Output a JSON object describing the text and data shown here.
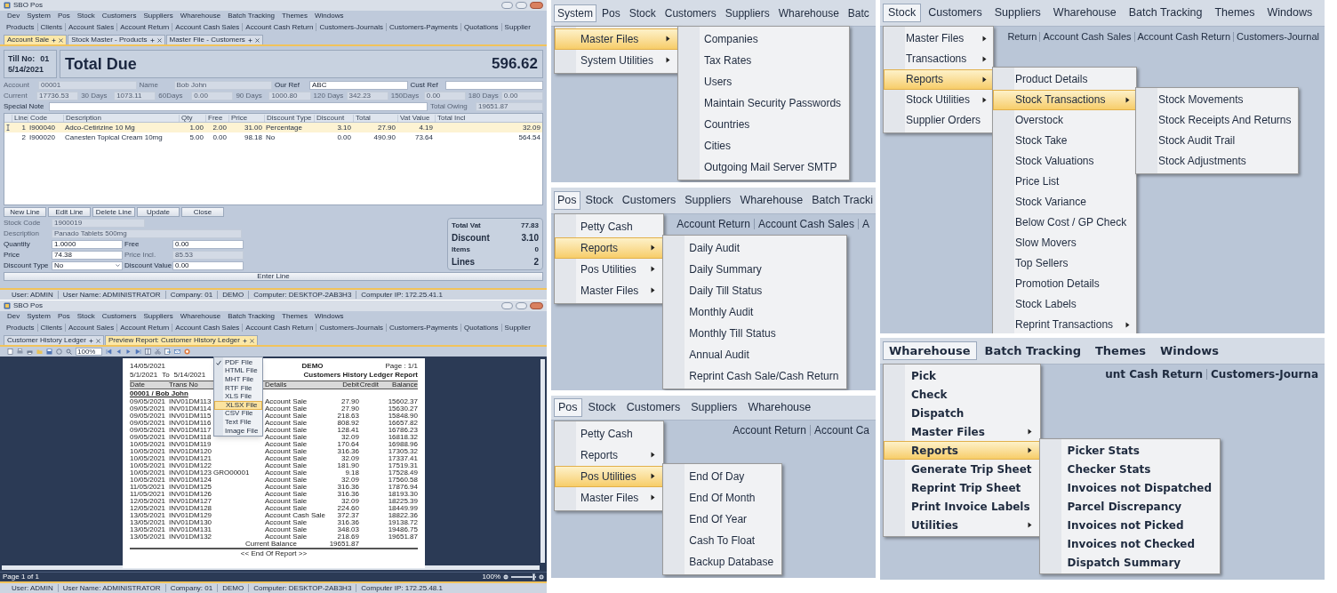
{
  "pos_window": {
    "title": "SBO Pos",
    "menubar": [
      "Dev",
      "System",
      "Pos",
      "Stock",
      "Customers",
      "Suppliers",
      "Wharehouse",
      "Batch Tracking",
      "Themes",
      "Windows"
    ],
    "toolbar": [
      "Products",
      "Clients",
      "Account Sales",
      "Account Return",
      "Account Cash Sales",
      "Account Cash Return",
      "Customers-Journals",
      "Customers-Payments",
      "Quotations",
      "Supplier"
    ],
    "tabs": [
      {
        "label": "Account Sale",
        "selected": true
      },
      {
        "label": "Stock Master - Products",
        "selected": false
      },
      {
        "label": "Master File - Customers",
        "selected": false
      }
    ],
    "till_label": "Till No:",
    "till_number": "01",
    "date": "5/14/2021",
    "total_due_label": "Total Due",
    "total_due": "596.62",
    "account_rows": [
      [
        {
          "label": "Account",
          "value": "00001",
          "editable": false
        },
        {
          "label": "Name",
          "value": "Bob John",
          "editable": false
        },
        {
          "label": "Our Ref",
          "value": "ABC",
          "editable": true
        },
        {
          "label": "Cust Ref",
          "editable": true
        }
      ],
      [
        {
          "label": "Current",
          "value": "17736.53",
          "editable": false
        },
        {
          "label": "30 Days",
          "value": "1073.11",
          "editable": false
        },
        {
          "label": "60Days",
          "value": "0.00",
          "editable": false
        },
        {
          "label": "90 Days",
          "value": "1000.80",
          "editable": false
        },
        {
          "label": "120 Days",
          "value": "342.23",
          "editable": false
        },
        {
          "label": "150Days",
          "value": "0.00",
          "editable": false
        },
        {
          "label": "180 Days",
          "value": "0.00",
          "editable": false
        }
      ],
      [
        {
          "label": "Special Note",
          "editable": true
        },
        {
          "label": "Total Owing",
          "value": "19651.87",
          "editable": false
        }
      ]
    ],
    "grid": {
      "columns": [
        "Line",
        "Code",
        "Description",
        "Qty",
        "Free",
        "Price",
        "Discount Type",
        "Discount",
        "Total",
        "Vat Value",
        "Total Incl"
      ],
      "rows": [
        {
          "selected": true,
          "cells": [
            "1",
            "I900040",
            "Adco-Cetirizine 10 Mg",
            "1.00",
            "2.00",
            "31.00",
            "Percentage",
            "3.10",
            "27.90",
            "4.19",
            "32.09"
          ]
        },
        {
          "selected": false,
          "cells": [
            "2",
            "I900020",
            "Canesten Topical Cream 10mg",
            "5.00",
            "0.00",
            "98.18",
            "No",
            "0.00",
            "490.90",
            "73.64",
            "564.54"
          ]
        }
      ]
    },
    "buttons": [
      "New Line",
      "Edit Line",
      "Delete Line",
      "Update",
      "Close"
    ],
    "line_form": [
      [
        {
          "label": "Stock Code",
          "value": "1900019",
          "editable": false,
          "kind": "text"
        }
      ],
      [
        {
          "label": "Description",
          "value": "Panado Tablets 500mg",
          "editable": false,
          "kind": "text"
        }
      ],
      [
        {
          "label": "Quantity",
          "value": "1.0000",
          "editable": true,
          "kind": "text"
        },
        {
          "label": "Free",
          "value": "0.00",
          "editable": true,
          "kind": "text"
        }
      ],
      [
        {
          "label": "Price",
          "value": "74.38",
          "editable": true,
          "kind": "text"
        },
        {
          "label": "Price Incl.",
          "value": "85.53",
          "editable": false,
          "kind": "text"
        }
      ],
      [
        {
          "label": "Discount Type",
          "value": "No",
          "editable": true,
          "kind": "select"
        },
        {
          "label": "Discount Value",
          "value": "0.00",
          "editable": true,
          "kind": "text"
        }
      ]
    ],
    "summary": [
      {
        "label": "Total Vat",
        "value": "77.83",
        "emphasis": false
      },
      {
        "label": "Discount",
        "value": "3.10",
        "emphasis": true
      },
      {
        "label": "Items",
        "value": "0",
        "emphasis": false
      },
      {
        "label": "Lines",
        "value": "2",
        "emphasis": true
      }
    ],
    "enter_button": "Enter Line",
    "status_bar": [
      "User: ADMIN",
      "User Name: ADMINISTRATOR",
      "Company: 01",
      "DEMO",
      "Computer: DESKTOP-2AB3H3",
      "Computer IP: 172.25.41.1"
    ]
  },
  "report_window": {
    "title": "SBO Pos",
    "menubar": [
      "Dev",
      "System",
      "Pos",
      "Stock",
      "Customers",
      "Suppliers",
      "Wharehouse",
      "Batch Tracking",
      "Themes",
      "Windows"
    ],
    "toolbar": [
      "Products",
      "Clients",
      "Account Sales",
      "Account Return",
      "Account Cash Sales",
      "Account Cash Return",
      "Customers-Journals",
      "Customers-Payments",
      "Quotations",
      "Supplier"
    ],
    "tabs": [
      {
        "label": "Customer History Ledger",
        "selected": false
      },
      {
        "label": "Preview Report: Customer History Ledger",
        "selected": true
      }
    ],
    "zoom_value": "100%",
    "report": {
      "print_date": "14/05/2021",
      "company": "DEMO",
      "page": "Page : 1/1",
      "from": "5/1/2021",
      "to_label": "To",
      "to": "5/14/2021",
      "title": "Customers History Ledger Report",
      "columns": [
        "Date",
        "Trans No",
        null,
        "Details",
        "Debit",
        "Credit",
        "Balance"
      ],
      "group": "00001 / Bob John",
      "rows": [
        [
          "09/05/2021",
          "INV01DM113",
          null,
          "Account Sale",
          "27.90",
          null,
          "15602.37"
        ],
        [
          "09/05/2021",
          "INV01DM114",
          null,
          "Account Sale",
          "27.90",
          null,
          "15630.27"
        ],
        [
          "09/05/2021",
          "INV01DM115",
          null,
          "Account Sale",
          "218.63",
          null,
          "15848.90"
        ],
        [
          "09/05/2021",
          "INV01DM116",
          null,
          "Account Sale",
          "808.92",
          null,
          "16657.82"
        ],
        [
          "09/05/2021",
          "INV01DM117",
          null,
          "Account Sale",
          "128.41",
          null,
          "16786.23"
        ],
        [
          "09/05/2021",
          "INV01DM118",
          null,
          "Account Sale",
          "32.09",
          null,
          "16818.32"
        ],
        [
          "10/05/2021",
          "INV01DM119",
          null,
          "Account Sale",
          "170.64",
          null,
          "16988.96"
        ],
        [
          "10/05/2021",
          "INV01DM120",
          null,
          "Account Sale",
          "316.36",
          null,
          "17305.32"
        ],
        [
          "10/05/2021",
          "INV01DM121",
          null,
          "Account Sale",
          "32.09",
          null,
          "17337.41"
        ],
        [
          "10/05/2021",
          "INV01DM122",
          null,
          "Account Sale",
          "181.90",
          null,
          "17519.31"
        ],
        [
          "10/05/2021",
          "INV01DM123",
          "GRO00001",
          "Account Sale",
          "9.18",
          null,
          "17528.49"
        ],
        [
          "10/05/2021",
          "INV01DM124",
          null,
          "Account Sale",
          "32.09",
          null,
          "17560.58"
        ],
        [
          "11/05/2021",
          "INV01DM125",
          null,
          "Account Sale",
          "316.36",
          null,
          "17876.94"
        ],
        [
          "11/05/2021",
          "INV01DM126",
          null,
          "Account Sale",
          "316.36",
          null,
          "18193.30"
        ],
        [
          "12/05/2021",
          "INV01DM127",
          null,
          "Account Sale",
          "32.09",
          null,
          "18225.39"
        ],
        [
          "12/05/2021",
          "INV01DM128",
          null,
          "Account Sale",
          "224.60",
          null,
          "18449.99"
        ],
        [
          "13/05/2021",
          "INV01DM129",
          null,
          "Account Cash Sale",
          "372.37",
          null,
          "18822.36"
        ],
        [
          "13/05/2021",
          "INV01DM130",
          null,
          "Account Sale",
          "316.36",
          null,
          "19138.72"
        ],
        [
          "13/05/2021",
          "INV01DM131",
          null,
          "Account Sale",
          "348.03",
          null,
          "19486.75"
        ],
        [
          "13/05/2021",
          "INV01DM132",
          null,
          "Account Sale",
          "218.69",
          null,
          "19651.87"
        ]
      ],
      "balance_label": "Current Balance",
      "balance": "19651.87",
      "end": "<< End Of Report >>"
    },
    "export_menu": [
      {
        "label": "PDF File",
        "checked": true,
        "selected": false
      },
      {
        "label": "HTML File",
        "checked": false,
        "selected": false
      },
      {
        "label": "MHT File",
        "checked": false,
        "selected": false
      },
      {
        "label": "RTF File",
        "checked": false,
        "selected": false
      },
      {
        "label": "XLS File",
        "checked": false,
        "selected": false
      },
      {
        "label": "XLSX File",
        "checked": false,
        "selected": true
      },
      {
        "label": "CSV File",
        "checked": false,
        "selected": false
      },
      {
        "label": "Text File",
        "checked": false,
        "selected": false
      },
      {
        "label": "Image File",
        "checked": false,
        "selected": false
      }
    ],
    "page_status": "Page 1 of 1",
    "zoom_percent": "100%",
    "zoom_slider": {
      "level": 0.9
    },
    "status_bar": [
      "User: ADMIN",
      "User Name: ADMINISTRATOR",
      "Company: 01",
      "DEMO",
      "Computer: DESKTOP-2AB3H3",
      "Computer IP: 172.25.48.1"
    ]
  },
  "menu_screens": [
    {
      "menubar": [
        {
          "label": "System",
          "selected": true
        },
        {
          "label": "Pos",
          "selected": false
        },
        {
          "label": "Stock",
          "selected": false
        },
        {
          "label": "Customers",
          "selected": false
        },
        {
          "label": "Suppliers",
          "selected": false
        },
        {
          "label": "Wharehouse",
          "selected": false
        },
        {
          "label": "Batc",
          "selected": false
        }
      ],
      "menus": [
        [
          {
            "label": "Master Files",
            "selected": true,
            "submenu": true
          },
          {
            "label": "System Utilities",
            "selected": false,
            "submenu": true
          }
        ],
        [
          {
            "label": "Companies",
            "selected": false,
            "submenu": false
          },
          {
            "label": "Tax Rates",
            "selected": false,
            "submenu": false
          },
          {
            "label": "Users",
            "selected": false,
            "submenu": false
          },
          {
            "label": "Maintain Security Passwords",
            "selected": false,
            "submenu": false
          },
          {
            "label": "Countries",
            "selected": false,
            "submenu": false
          },
          {
            "label": "Cities",
            "selected": false,
            "submenu": false
          },
          {
            "label": "Outgoing Mail Server SMTP",
            "selected": false,
            "submenu": false
          }
        ]
      ]
    },
    {
      "menubar": [
        {
          "label": "Pos",
          "selected": true
        },
        {
          "label": "Stock",
          "selected": false
        },
        {
          "label": "Customers",
          "selected": false
        },
        {
          "label": "Suppliers",
          "selected": false
        },
        {
          "label": "Wharehouse",
          "selected": false
        },
        {
          "label": "Batch Tracki",
          "selected": false
        }
      ],
      "toolbar": [
        "Account Return",
        "Account Cash Sales",
        "A"
      ],
      "menus": [
        [
          {
            "label": "Petty Cash",
            "selected": false,
            "submenu": false
          },
          {
            "label": "Reports",
            "selected": true,
            "submenu": true
          },
          {
            "label": "Pos Utilities",
            "selected": false,
            "submenu": true
          },
          {
            "label": "Master Files",
            "selected": false,
            "submenu": true
          }
        ],
        [
          {
            "label": "Daily Audit",
            "selected": false,
            "submenu": false
          },
          {
            "label": "Daily Summary",
            "selected": false,
            "submenu": false
          },
          {
            "label": "Daily Till Status",
            "selected": false,
            "submenu": false
          },
          {
            "label": "Monthly Audit",
            "selected": false,
            "submenu": false
          },
          {
            "label": "Monthly Till Status",
            "selected": false,
            "submenu": false
          },
          {
            "label": "Annual Audit",
            "selected": false,
            "submenu": false
          },
          {
            "label": "Reprint Cash Sale/Cash Return",
            "selected": false,
            "submenu": false
          }
        ]
      ]
    },
    {
      "menubar": [
        {
          "label": "Pos",
          "selected": true
        },
        {
          "label": "Stock",
          "selected": false
        },
        {
          "label": "Customers",
          "selected": false
        },
        {
          "label": "Suppliers",
          "selected": false
        },
        {
          "label": "Wharehouse",
          "selected": false
        }
      ],
      "toolbar": [
        "Account Return",
        "Account Ca"
      ],
      "menus": [
        [
          {
            "label": "Petty Cash",
            "selected": false,
            "submenu": false
          },
          {
            "label": "Reports",
            "selected": false,
            "submenu": true
          },
          {
            "label": "Pos Utilities",
            "selected": true,
            "submenu": true
          },
          {
            "label": "Master Files",
            "selected": false,
            "submenu": true
          }
        ],
        [
          {
            "label": "End Of Day",
            "selected": false,
            "submenu": false
          },
          {
            "label": "End Of Month",
            "selected": false,
            "submenu": false
          },
          {
            "label": "End Of Year",
            "selected": false,
            "submenu": false
          },
          {
            "label": "Cash To Float",
            "selected": false,
            "submenu": false
          },
          {
            "label": "Backup Database",
            "selected": false,
            "submenu": false
          }
        ]
      ]
    },
    {
      "menubar": [
        {
          "label": "Stock",
          "selected": true
        },
        {
          "label": "Customers",
          "selected": false
        },
        {
          "label": "Suppliers",
          "selected": false
        },
        {
          "label": "Wharehouse",
          "selected": false
        },
        {
          "label": "Batch Tracking",
          "selected": false
        },
        {
          "label": "Themes",
          "selected": false
        },
        {
          "label": "Windows",
          "selected": false
        }
      ],
      "toolbar": [
        "Return",
        "Account Cash Sales",
        "Account Cash Return",
        "Customers-Journal"
      ],
      "menus": [
        [
          {
            "label": "Master Files",
            "selected": false,
            "submenu": true
          },
          {
            "label": "Transactions",
            "selected": false,
            "submenu": true
          },
          {
            "label": "Reports",
            "selected": true,
            "submenu": true
          },
          {
            "label": "Stock Utilities",
            "selected": false,
            "submenu": true
          },
          {
            "label": "Supplier Orders",
            "selected": false,
            "submenu": false
          }
        ],
        [
          {
            "label": "Product Details",
            "selected": false,
            "submenu": false
          },
          {
            "label": "Stock Transactions",
            "selected": true,
            "submenu": true
          },
          {
            "label": "Overstock",
            "selected": false,
            "submenu": false
          },
          {
            "label": "Stock Take",
            "selected": false,
            "submenu": false
          },
          {
            "label": "Stock Valuations",
            "selected": false,
            "submenu": false
          },
          {
            "label": "Price List",
            "selected": false,
            "submenu": false
          },
          {
            "label": "Stock Variance",
            "selected": false,
            "submenu": false
          },
          {
            "label": "Below Cost / GP Check",
            "selected": false,
            "submenu": false
          },
          {
            "label": "Slow Movers",
            "selected": false,
            "submenu": false
          },
          {
            "label": "Top Sellers",
            "selected": false,
            "submenu": false
          },
          {
            "label": "Promotion Details",
            "selected": false,
            "submenu": false
          },
          {
            "label": "Stock Labels",
            "selected": false,
            "submenu": false
          },
          {
            "label": "Reprint Transactions",
            "selected": false,
            "submenu": true
          }
        ],
        [
          {
            "label": "Stock Movements",
            "selected": false,
            "submenu": false
          },
          {
            "label": "Stock Receipts And Returns",
            "selected": false,
            "submenu": false
          },
          {
            "label": "Stock Audit Trail",
            "selected": false,
            "submenu": false
          },
          {
            "label": "Stock Adjustments",
            "selected": false,
            "submenu": false
          }
        ]
      ]
    },
    {
      "menubar": [
        {
          "label": "Wharehouse",
          "selected": true
        },
        {
          "label": "Batch Tracking",
          "selected": false
        },
        {
          "label": "Themes",
          "selected": false
        },
        {
          "label": "Windows",
          "selected": false
        }
      ],
      "toolbar": [
        "unt Cash Return",
        "Customers-Journa"
      ],
      "menus": [
        [
          {
            "label": "Pick",
            "selected": false,
            "submenu": false
          },
          {
            "label": "Check",
            "selected": false,
            "submenu": false
          },
          {
            "label": "Dispatch",
            "selected": false,
            "submenu": false
          },
          {
            "label": "Master Files",
            "selected": false,
            "submenu": true
          },
          {
            "label": "Reports",
            "selected": true,
            "submenu": true
          },
          {
            "label": "Generate Trip Sheet",
            "selected": false,
            "submenu": false
          },
          {
            "label": "Reprint Trip Sheet",
            "selected": false,
            "submenu": false
          },
          {
            "label": "Print Invoice Labels",
            "selected": false,
            "submenu": false
          },
          {
            "label": "Utilities",
            "selected": false,
            "submenu": true
          }
        ],
        [
          {
            "label": "Picker Stats",
            "selected": false,
            "submenu": false
          },
          {
            "label": "Checker Stats",
            "selected": false,
            "submenu": false
          },
          {
            "label": "Invoices not Dispatched",
            "selected": false,
            "submenu": false
          },
          {
            "label": "Parcel Discrepancy",
            "selected": false,
            "submenu": false
          },
          {
            "label": "Invoices not Picked",
            "selected": false,
            "submenu": false
          },
          {
            "label": "Invoices not Checked",
            "selected": false,
            "submenu": false
          },
          {
            "label": "Dispatch Summary",
            "selected": false,
            "submenu": false
          }
        ]
      ]
    }
  ]
}
